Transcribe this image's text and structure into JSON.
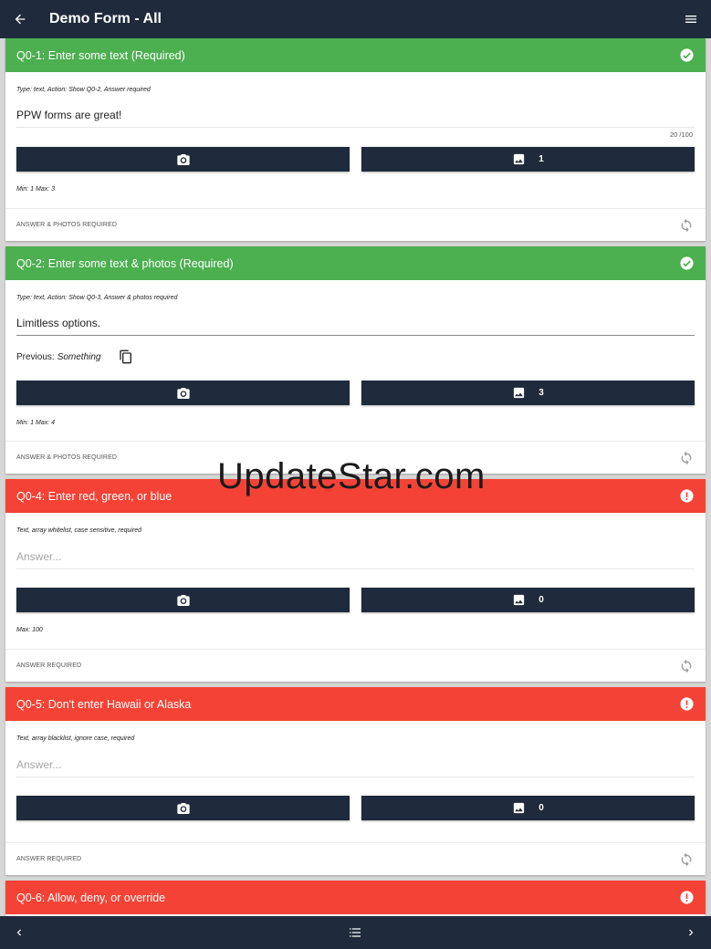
{
  "appbar": {
    "title": "Demo Form - All"
  },
  "questions": [
    {
      "title": "Q0-1: Enter some text (Required)",
      "status": "ok",
      "meta": "Type: text, Action: Show Q0-2, Answer required",
      "answer": "PPW forms are great!",
      "counter": "20 /100",
      "photo_count": "1",
      "minmax": "Min: 1 Max: 3",
      "footer": "ANSWER & PHOTOS REQUIRED"
    },
    {
      "title": "Q0-2: Enter some text & photos (Required)",
      "status": "ok",
      "meta": "Type: text, Action: Show Q0-3, Answer & photos required",
      "answer": "Limitless options.",
      "previous_label": "Previous:",
      "previous_value": "Something",
      "photo_count": "3",
      "minmax": "Min: 1 Max: 4",
      "footer": "ANSWER & PHOTOS REQUIRED"
    },
    {
      "title": "Q0-4: Enter red, green, or blue",
      "status": "error",
      "meta": "Text, array whitelist, case sensitive, required",
      "placeholder": "Answer...",
      "photo_count": "0",
      "minmax": "Max: 100",
      "footer": "ANSWER REQUIRED"
    },
    {
      "title": "Q0-5: Don't enter Hawaii or Alaska",
      "status": "error",
      "meta": "Text, array blacklist, ignore case, required",
      "placeholder": "Answer...",
      "photo_count": "0",
      "footer": "ANSWER REQUIRED"
    },
    {
      "title": "Q0-6: Allow, deny, or override",
      "status": "error"
    }
  ],
  "watermark": "UpdateStar.com",
  "colors": {
    "header": "#1f2b3c",
    "ok": "#4caf50",
    "error": "#f44336"
  }
}
